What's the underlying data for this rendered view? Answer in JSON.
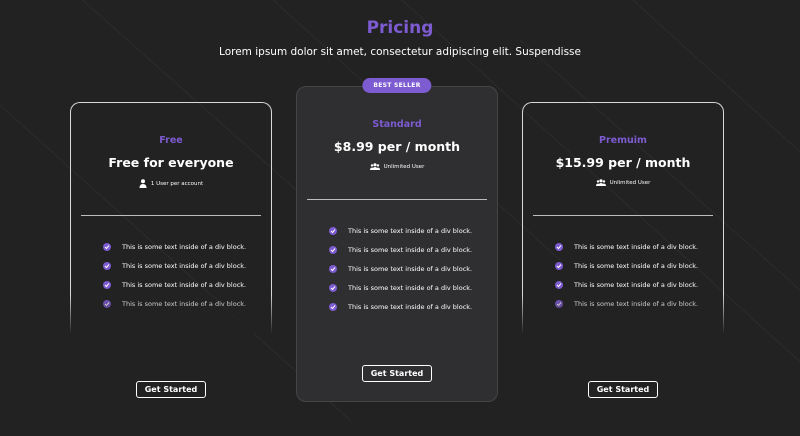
{
  "header": {
    "title": "Pricing",
    "subtitle": "Lorem ipsum dolor sit amet, consectetur adipiscing elit. Suspendisse"
  },
  "plans": [
    {
      "name": "Free",
      "price": "Free for everyone",
      "meta": "1 User per account",
      "meta_icon": "user-icon",
      "features": [
        "This is some text inside of a div block.",
        "This is some text inside of a div block.",
        "This is some text inside of a div block.",
        "This is some text inside of a div block."
      ],
      "cta": "Get Started"
    },
    {
      "badge": "BEST SELLER",
      "name": "Standard",
      "price": "$8.99 per / month",
      "meta": "Unlimited User",
      "meta_icon": "users-icon",
      "features": [
        "This is some text inside of a div block.",
        "This is some text inside of a div block.",
        "This is some text inside of a div block.",
        "This is some text inside of a div block.",
        "This is some text inside of a div block."
      ],
      "cta": "Get Started"
    },
    {
      "name": "Premuim",
      "price": "$15.99 per / month",
      "meta": "Unlimited User",
      "meta_icon": "users-icon",
      "features": [
        "This is some text inside of a div block.",
        "This is some text inside of a div block.",
        "This is some text inside of a div block.",
        "This is some text inside of a div block."
      ],
      "cta": "Get Started"
    }
  ],
  "colors": {
    "background": "#222222",
    "accent": "#7d5bd0",
    "featured_card": "#2f2f31",
    "text": "#ffffff"
  }
}
